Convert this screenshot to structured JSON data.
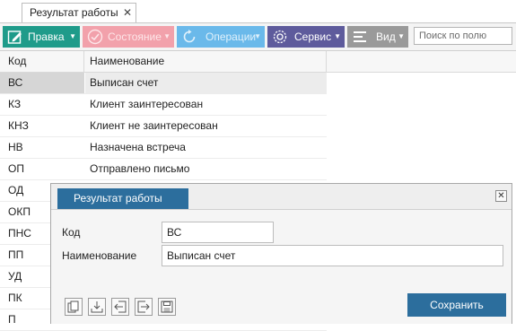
{
  "tab": {
    "title": "Результат работы",
    "close": "✕"
  },
  "toolbar": {
    "edit_label": "Правка",
    "status_label": "Состояние",
    "operations_label": "Операции",
    "service_label": "Сервис",
    "view_label": "Вид",
    "dropdown_arrow": "▼",
    "search_placeholder": "Поиск по полю"
  },
  "grid": {
    "columns": [
      "Код",
      "Наименование"
    ],
    "rows": [
      [
        "ВС",
        "Выписан счет"
      ],
      [
        "КЗ",
        "Клиент заинтересован"
      ],
      [
        "КНЗ",
        "Клиент не заинтересован"
      ],
      [
        "НВ",
        "Назначена встреча"
      ],
      [
        "ОП",
        "Отправлено письмо"
      ],
      [
        "ОД",
        ""
      ],
      [
        "ОКП",
        ""
      ],
      [
        "ПНС",
        ""
      ],
      [
        "ПП",
        ""
      ],
      [
        "УД",
        ""
      ],
      [
        "ПК",
        ""
      ],
      [
        "П",
        ""
      ]
    ],
    "selected_row": 0
  },
  "dialog": {
    "title": "Результат работы",
    "close": "✕",
    "code_label": "Код",
    "code_value": "ВС",
    "name_label": "Наименование",
    "name_value": "Выписан счет",
    "save_label": "Сохранить",
    "icon_buttons": [
      "copy-icon",
      "download-icon",
      "import-icon",
      "export-icon",
      "save-disk-icon"
    ]
  },
  "colors": {
    "edit": "#1f9b8a",
    "status": "#f2a1ab",
    "operations": "#6ab9ea",
    "service": "#5e5b9c",
    "view": "#9a9a9a",
    "dialog_accent": "#2c6e9d"
  }
}
